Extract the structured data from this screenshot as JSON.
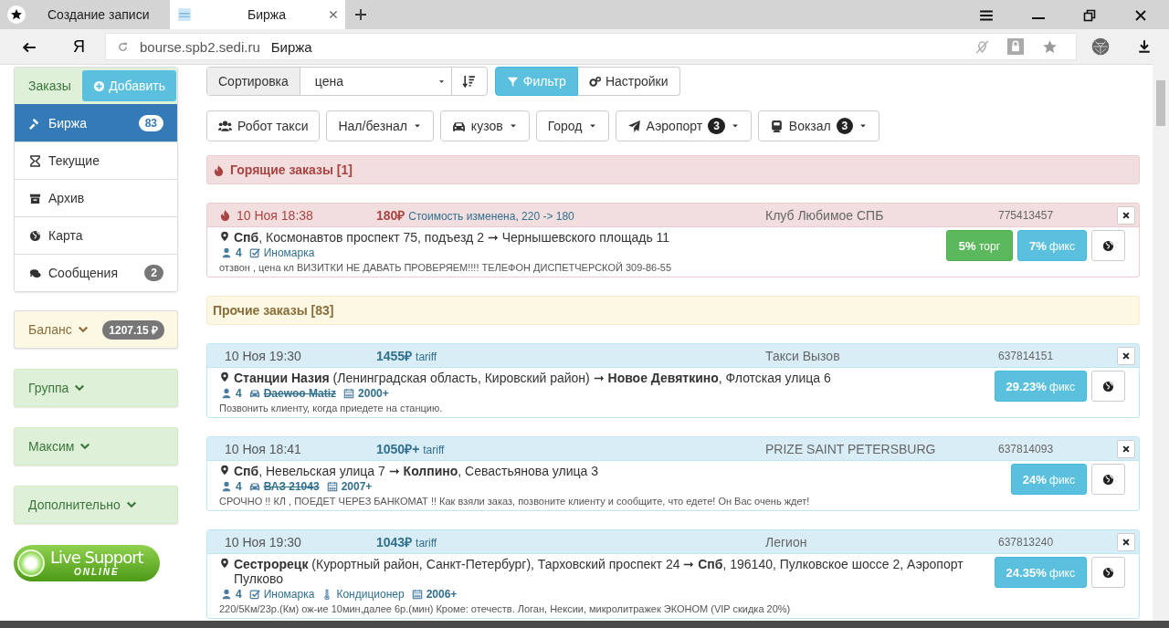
{
  "browser": {
    "tabs": [
      {
        "title": "Создание записи",
        "selected": false
      },
      {
        "title": "Биржа",
        "selected": true
      }
    ],
    "logo": "Я",
    "address": {
      "domain": "bourse.spb2.sedi.ru",
      "page_title": "Биржа"
    }
  },
  "sidebar": {
    "orders": {
      "label": "Заказы",
      "add_button": "Добавить"
    },
    "nav": [
      {
        "kind": "gavel",
        "label": "Биржа",
        "badge": "83",
        "selected": true
      },
      {
        "kind": "hourglass",
        "label": "Текущие",
        "selected": false
      },
      {
        "kind": "archive",
        "label": "Архив",
        "selected": false
      },
      {
        "kind": "globe",
        "label": "Карта",
        "selected": false
      },
      {
        "kind": "comments",
        "label": "Сообщения",
        "badge": "2",
        "selected": false
      }
    ],
    "balance": {
      "label": "Баланс",
      "amount": "1207.15 ₽"
    },
    "panels": [
      {
        "label": "Группа"
      },
      {
        "label": "Максим"
      },
      {
        "label": "Дополнительно"
      }
    ],
    "live_support": {
      "title": "Live Support",
      "status": "ONLINE"
    }
  },
  "toolbar": {
    "sort_label": "Сортировка",
    "sort_value": "цена",
    "buttons": [
      {
        "kind": "filter",
        "label": "Фильтр",
        "active": true
      },
      {
        "kind": "gears",
        "label": "Настройки",
        "active": false
      }
    ]
  },
  "filters": [
    {
      "kind": "users",
      "label": "Робот такси",
      "dropdown": false
    },
    {
      "kind": "plain",
      "label": "Нал/безнал",
      "dropdown": true
    },
    {
      "kind": "car",
      "label": "кузов",
      "dropdown": true
    },
    {
      "kind": "plain",
      "label": "Город",
      "dropdown": true
    },
    {
      "kind": "plane",
      "label": "Аэропорт",
      "badge": "3",
      "dropdown": true
    },
    {
      "kind": "train",
      "label": "Вокзал",
      "badge": "3",
      "dropdown": true
    }
  ],
  "sections": [
    {
      "kind": "hot",
      "title": "Горящие заказы [1]",
      "orders": [
        {
          "hot": true,
          "time": "10 Ноя 18:38",
          "price": "180₽",
          "price_note": "Стоимость изменена, 220 -> 180",
          "company": "Клуб Любимое СПБ",
          "number": "775413457",
          "route": "**Спб**, Космонавтов проспект 75, подъезд 2 ➞ Чернышевского площадь 11",
          "tags": [
            {
              "kind": "passengers",
              "label": "4",
              "struck": false
            },
            {
              "kind": "check",
              "label": "Иномарка",
              "struck": false
            }
          ],
          "comment": "отзвон , цена кл ВИЗИТКИ НЕ ДАВАТЬ ПРОВЕРЯЕМ!!!! ТЕЛЕФОН ДИСПЕТЧЕРСКОЙ 309-86-55",
          "offers": [
            {
              "kind": "success",
              "label": "**5%** торг"
            },
            {
              "kind": "info",
              "label": "**7%** фикс"
            }
          ]
        }
      ]
    },
    {
      "kind": "other",
      "title": "Прочие заказы [83]",
      "orders": [
        {
          "hot": false,
          "time": "10 Ноя 19:30",
          "price": "1455₽",
          "price_note": "tariff",
          "company": "Такси Вызов",
          "number": "637814151",
          "route": "**Станции Назия** (Ленинградская область, Кировский район) ➞ **Новое Девяткино**, Флотская улица 6",
          "tags": [
            {
              "kind": "passengers",
              "label": "4",
              "struck": false
            },
            {
              "kind": "car",
              "label": "Daewoo Matiz",
              "struck": true
            },
            {
              "kind": "year",
              "label": "2000+",
              "struck": false
            }
          ],
          "comment": "Позвонить клиенту, когда приедете на станцию.",
          "offers": [
            {
              "kind": "info",
              "label": "**29.23%** фикс"
            }
          ]
        },
        {
          "hot": false,
          "time": "10 Ноя 18:41",
          "price": "1050₽+",
          "price_note": "tariff",
          "company": "PRIZE SAINT PETERSBURG",
          "number": "637814093",
          "route": "**Спб**, Невельская улица 7 ➞ **Колпино**, Севастьянова улица 3",
          "tags": [
            {
              "kind": "passengers",
              "label": "4",
              "struck": false
            },
            {
              "kind": "car",
              "label": "ВАЗ 21043",
              "struck": true
            },
            {
              "kind": "year",
              "label": "2007+",
              "struck": false
            }
          ],
          "comment": "СРОЧНО !! КЛ , ПОЕДЕТ ЧЕРЕЗ БАНКОМАТ !! Как взяли заказ, позвоните клиенту и сообщите, что едете! Он Вас очень ждет!",
          "offers": [
            {
              "kind": "info",
              "label": "**24%** фикс"
            }
          ]
        },
        {
          "hot": false,
          "time": "10 Ноя 19:30",
          "price": "1043₽",
          "price_note": "tariff",
          "company": "Легион",
          "number": "637813240",
          "route": "**Сестрорецк** (Курортный район, Санкт-Петербург), Тарховский проспект 24 ➞ **Спб**, 196140, Пулковское шоссе 2, Аэропорт Пулково",
          "tags": [
            {
              "kind": "passengers",
              "label": "4",
              "struck": false
            },
            {
              "kind": "check",
              "label": "Иномарка",
              "struck": false
            },
            {
              "kind": "climate",
              "label": "Кондиционер",
              "struck": false
            },
            {
              "kind": "year",
              "label": "2006+",
              "struck": false
            }
          ],
          "comment": "220/5Км/23р.(Км) ож-ие 10мин,далее 6р.(мин) Кроме: отечеств. Логан, Нексии, микролитражек ЭКОНОМ (VIP скидка 20%)",
          "offers": [
            {
              "kind": "info",
              "label": "**24.35%** фикс"
            }
          ]
        }
      ]
    }
  ]
}
